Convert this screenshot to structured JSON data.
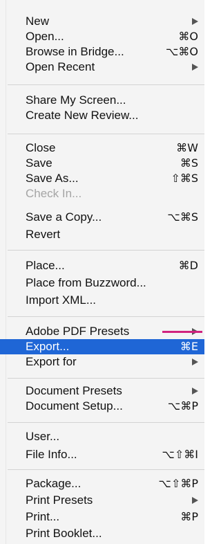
{
  "menu": {
    "groups": [
      {
        "items": [
          {
            "label": "New",
            "shortcut": "",
            "submenu": true
          },
          {
            "label": "Open...",
            "shortcut": "⌘O",
            "submenu": false
          },
          {
            "label": "Browse in Bridge...",
            "shortcut": "⌥⌘O",
            "submenu": false
          },
          {
            "label": "Open Recent",
            "shortcut": "",
            "submenu": true
          }
        ]
      },
      {
        "items": [
          {
            "label": "Share My Screen...",
            "shortcut": "",
            "submenu": false
          },
          {
            "label": "Create New Review...",
            "shortcut": "",
            "submenu": false
          }
        ]
      },
      {
        "items": [
          {
            "label": "Close",
            "shortcut": "⌘W",
            "submenu": false
          },
          {
            "label": "Save",
            "shortcut": "⌘S",
            "submenu": false
          },
          {
            "label": "Save As...",
            "shortcut": "⇧⌘S",
            "submenu": false
          },
          {
            "label": "Check In...",
            "shortcut": "",
            "submenu": false,
            "disabled": true
          },
          {
            "label": "Save a Copy...",
            "shortcut": "⌥⌘S",
            "submenu": false
          },
          {
            "label": "Revert",
            "shortcut": "",
            "submenu": false
          }
        ]
      },
      {
        "items": [
          {
            "label": "Place...",
            "shortcut": "⌘D",
            "submenu": false
          },
          {
            "label": "Place from Buzzword...",
            "shortcut": "",
            "submenu": false
          },
          {
            "label": "Import XML...",
            "shortcut": "",
            "submenu": false
          }
        ]
      },
      {
        "items": [
          {
            "label": "Adobe PDF Presets",
            "shortcut": "",
            "submenu": true
          },
          {
            "label": "Export...",
            "shortcut": "⌘E",
            "submenu": false,
            "selected": true
          },
          {
            "label": "Export for",
            "shortcut": "",
            "submenu": true
          }
        ]
      },
      {
        "items": [
          {
            "label": "Document Presets",
            "shortcut": "",
            "submenu": true
          },
          {
            "label": "Document Setup...",
            "shortcut": "⌥⌘P",
            "submenu": false
          }
        ]
      },
      {
        "items": [
          {
            "label": "User...",
            "shortcut": "",
            "submenu": false
          },
          {
            "label": "File Info...",
            "shortcut": "⌥⇧⌘I",
            "submenu": false
          }
        ]
      },
      {
        "items": [
          {
            "label": "Package...",
            "shortcut": "⌥⇧⌘P",
            "submenu": false
          },
          {
            "label": "Print Presets",
            "shortcut": "",
            "submenu": true
          },
          {
            "label": "Print...",
            "shortcut": "⌘P",
            "submenu": false
          },
          {
            "label": "Print Booklet...",
            "shortcut": "",
            "submenu": false
          }
        ]
      }
    ]
  },
  "colors": {
    "menu_bg": "#f4f4f4",
    "selected_bg": "#1f66d6",
    "disabled_text": "#a5a5a5",
    "annotation": "#d0237f"
  }
}
